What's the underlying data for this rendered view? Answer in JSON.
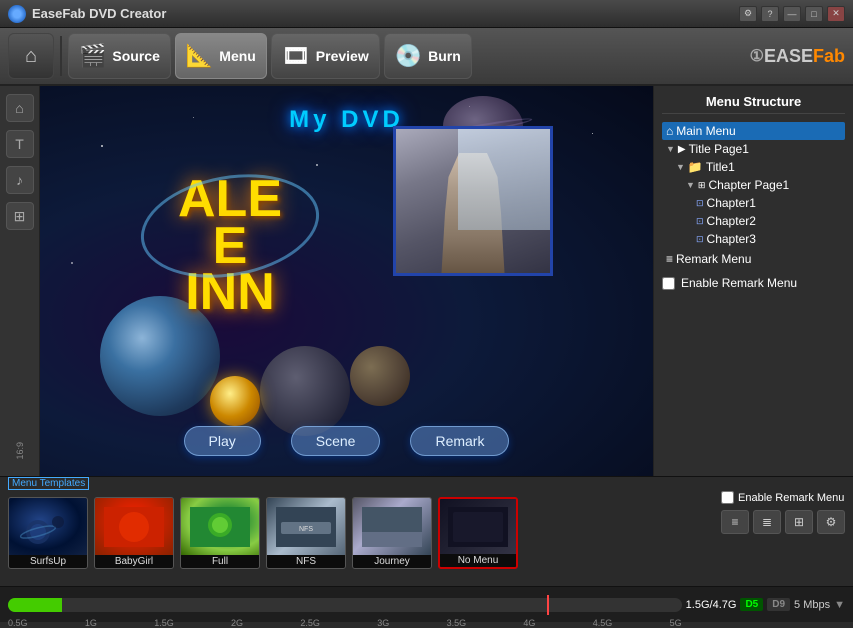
{
  "app": {
    "title": "EaseFab DVD Creator"
  },
  "titlebar": {
    "title": "EaseFab DVD Creator",
    "controls": {
      "settings": "⚙",
      "help": "?",
      "minimize": "—",
      "maximize": "□",
      "close": "✕"
    }
  },
  "toolbar": {
    "home_icon": "⌂",
    "source_label": "Source",
    "menu_label": "Menu",
    "preview_label": "Preview",
    "burn_label": "Burn",
    "brand_ease": "①EASE",
    "brand_fab": "Fab"
  },
  "sidebar": {
    "items": [
      {
        "icon": "⌂",
        "label": "home"
      },
      {
        "icon": "T",
        "label": "text"
      },
      {
        "icon": "♪",
        "label": "music"
      },
      {
        "icon": "⊞",
        "label": "grid"
      },
      {
        "icon": "16:9",
        "label": "aspect"
      }
    ]
  },
  "preview": {
    "title": "My  DVD",
    "buttons": [
      "Play",
      "Scene",
      "Remark"
    ]
  },
  "menu_structure": {
    "title": "Menu Structure",
    "items": [
      {
        "id": "main-menu",
        "label": "Main Menu",
        "indent": 0,
        "selected": true,
        "icon": "⌂",
        "chevron": ""
      },
      {
        "id": "title-page1",
        "label": "Title Page1",
        "indent": 1,
        "icon": "▶",
        "chevron": "▼"
      },
      {
        "id": "title1",
        "label": "Title1",
        "indent": 2,
        "icon": "📁",
        "chevron": "▼"
      },
      {
        "id": "chapter-page1",
        "label": "Chapter Page1",
        "indent": 3,
        "icon": "⊞",
        "chevron": "▼"
      },
      {
        "id": "chapter1",
        "label": "Chapter1",
        "indent": 4,
        "icon": "⊡"
      },
      {
        "id": "chapter2",
        "label": "Chapter2",
        "indent": 4,
        "icon": "⊡"
      },
      {
        "id": "chapter3",
        "label": "Chapter3",
        "indent": 4,
        "icon": "⊡"
      },
      {
        "id": "remark-menu",
        "label": "Remark Menu",
        "indent": 0,
        "icon": "≡"
      }
    ],
    "enable_remark_label": "Enable Remark Menu"
  },
  "templates": {
    "label": "Menu Templates",
    "items": [
      {
        "id": "surfsup",
        "name": "SurfsUp",
        "thumb": "surfsup",
        "selected": false
      },
      {
        "id": "babygirl",
        "name": "BabyGirl",
        "thumb": "babygirl",
        "selected": false
      },
      {
        "id": "full",
        "name": "Full",
        "thumb": "full",
        "selected": false
      },
      {
        "id": "nfs",
        "name": "NFS",
        "thumb": "nfs",
        "selected": false
      },
      {
        "id": "journey",
        "name": "Journey",
        "thumb": "journey",
        "selected": false
      },
      {
        "id": "nomenu",
        "name": "No Menu",
        "thumb": "nomenu",
        "selected": true
      }
    ],
    "ctrl_buttons": [
      "≡",
      "≣",
      "⊞",
      "⚙"
    ]
  },
  "progressbar": {
    "labels": [
      "0.5G",
      "1G",
      "1.5G",
      "2G",
      "2.5G",
      "3G",
      "3.5G",
      "4G",
      "4.5G",
      "5G"
    ],
    "size_info": "1.5G/4.7G",
    "d5_label": "D5",
    "d9_label": "D9",
    "mbps_label": "5 Mbps"
  }
}
